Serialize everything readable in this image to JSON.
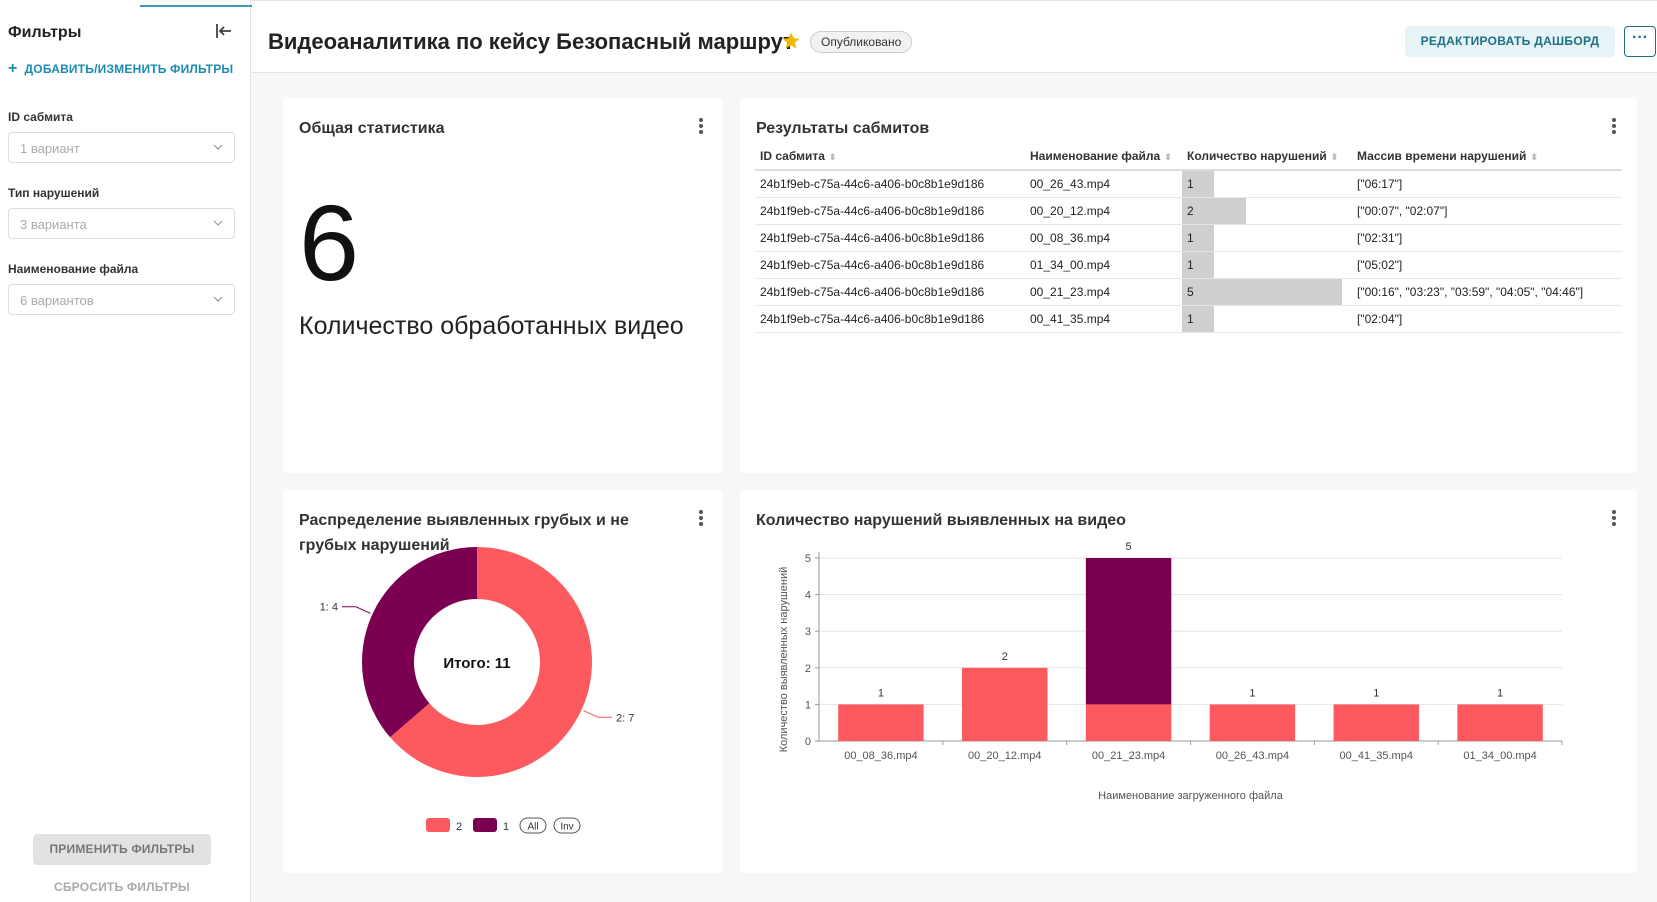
{
  "sidebar": {
    "title": "Фильтры",
    "add_filters": "ДОБАВИТЬ/ИЗМЕНИТЬ ФИЛЬТРЫ",
    "filters": [
      {
        "label": "ID сабмита",
        "placeholder": "1 вариант"
      },
      {
        "label": "Тип нарушений",
        "placeholder": "3 варианта"
      },
      {
        "label": "Наименование файла",
        "placeholder": "6 вариантов"
      }
    ],
    "apply": "ПРИМЕНИТЬ ФИЛЬТРЫ",
    "reset": "СБРОСИТЬ ФИЛЬТРЫ"
  },
  "header": {
    "title": "Видеоаналитика по кейсу Безопасный маршрут",
    "status": "Опубликовано",
    "edit": "РЕДАКТИРОВАТЬ ДАШБОРД",
    "more": "···"
  },
  "stats": {
    "title": "Общая статистика",
    "value": "6",
    "label": "Количество обработанных видео"
  },
  "table": {
    "title": "Результаты сабмитов",
    "columns": [
      "ID сабмита",
      "Наименование файла",
      "Количество нарушений",
      "Массив времени нарушений"
    ],
    "max_count": 5,
    "rows": [
      {
        "id": "24b1f9eb-c75a-44c6-a406-b0c8b1e9d186",
        "file": "00_26_43.mp4",
        "count": 1,
        "times": "[\"06:17\"]"
      },
      {
        "id": "24b1f9eb-c75a-44c6-a406-b0c8b1e9d186",
        "file": "00_20_12.mp4",
        "count": 2,
        "times": "[\"00:07\", \"02:07\"]"
      },
      {
        "id": "24b1f9eb-c75a-44c6-a406-b0c8b1e9d186",
        "file": "00_08_36.mp4",
        "count": 1,
        "times": "[\"02:31\"]"
      },
      {
        "id": "24b1f9eb-c75a-44c6-a406-b0c8b1e9d186",
        "file": "01_34_00.mp4",
        "count": 1,
        "times": "[\"05:02\"]"
      },
      {
        "id": "24b1f9eb-c75a-44c6-a406-b0c8b1e9d186",
        "file": "00_21_23.mp4",
        "count": 5,
        "times": "[\"00:16\", \"03:23\", \"03:59\", \"04:05\", \"04:46\"]"
      },
      {
        "id": "24b1f9eb-c75a-44c6-a406-b0c8b1e9d186",
        "file": "00_41_35.mp4",
        "count": 1,
        "times": "[\"02:04\"]"
      }
    ]
  },
  "donut": {
    "title_line1": "Распределение выявленных грубых и не",
    "title_line2": "грубых нарушений",
    "center_label": "Итого: 11",
    "legend_all": "All",
    "legend_inv": "Inv"
  },
  "bars": {
    "title": "Количество нарушений выявленных на видео"
  },
  "colors": {
    "series_2": "#fc5a5e",
    "series_1": "#7b0051",
    "accent": "#1a8bb0"
  },
  "chart_data": [
    {
      "type": "pie",
      "variant": "donut",
      "title": "Распределение выявленных грубых и не грубых нарушений",
      "slices": [
        {
          "label": "2",
          "value": 7
        },
        {
          "label": "1",
          "value": 4
        }
      ],
      "total_label": "Итого: 11",
      "legend": "bottom"
    },
    {
      "type": "bar",
      "stacked": true,
      "title": "Количество нарушений выявленных на видео",
      "xlabel": "Наименование загруженного файла",
      "ylabel": "Количество выявленных нарушений",
      "categories": [
        "00_08_36.mp4",
        "00_20_12.mp4",
        "00_21_23.mp4",
        "00_26_43.mp4",
        "00_41_35.mp4",
        "01_34_00.mp4"
      ],
      "series": [
        {
          "name": "2",
          "values": [
            1,
            2,
            1,
            1,
            1,
            1
          ]
        },
        {
          "name": "1",
          "values": [
            0,
            0,
            4,
            0,
            0,
            0
          ]
        }
      ],
      "totals": [
        1,
        2,
        5,
        1,
        1,
        1
      ],
      "ylim": [
        0,
        5
      ],
      "yticks": [
        0,
        1,
        2,
        3,
        4,
        5
      ],
      "grid": true
    }
  ]
}
